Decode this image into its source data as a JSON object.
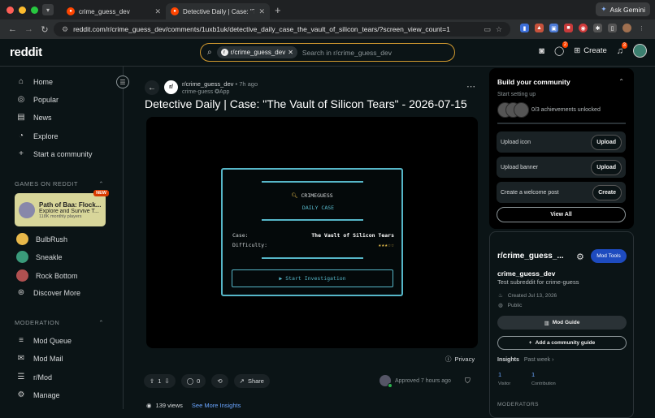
{
  "browser": {
    "tabs": [
      {
        "title": "crime_guess_dev",
        "active": false
      },
      {
        "title": "Detective Daily | Case: \"The ",
        "active": true
      }
    ],
    "gemini_label": "Ask Gemini",
    "url": "reddit.com/r/crime_guess_dev/comments/1uxb1uk/detective_daily_case_the_vault_of_silicon_tears/?screen_view_count=1"
  },
  "header": {
    "logo": "reddit",
    "search_chip": "r/crime_guess_dev",
    "search_placeholder": "Search in r/crime_guess_dev",
    "create_label": "Create",
    "chat_badge": "2",
    "notif_badge": "3"
  },
  "sidebar": {
    "nav": [
      "Home",
      "Popular",
      "News",
      "Explore",
      "Start a community"
    ],
    "games_heading": "GAMES ON REDDIT",
    "featured_game": {
      "title": "Path of Baa: Flock...",
      "subtitle": "Explore and Survive T...",
      "players": "118K monthly players",
      "badge": "NEW"
    },
    "games": [
      "BulbRush",
      "Sneakle",
      "Rock Bottom",
      "Discover More"
    ],
    "moderation_heading": "MODERATION",
    "moderation": [
      "Mod Queue",
      "Mod Mail",
      "r/Mod",
      "Manage"
    ]
  },
  "post": {
    "subreddit": "r/crime_guess_dev",
    "time": "7h ago",
    "author": "crime-guess",
    "app_tag": "App",
    "title": "Detective Daily | Case: \"The Vault of Silicon Tears\" - 2026-07-15",
    "game": {
      "brand": "CRIMEGUESS",
      "subtitle": "DAILY CASE",
      "case_label": "Case:",
      "case_value": "The Vault of Silicon Tears",
      "difficulty_label": "Difficulty:",
      "difficulty_stars": "★★★☆☆",
      "button": "▶ Start Investigation"
    },
    "privacy": "Privacy",
    "votes": "1",
    "comments": "0",
    "share": "Share",
    "approved": "Approved 7 hours ago",
    "views": "139 views",
    "insights_link": "See More Insights"
  },
  "right": {
    "build": {
      "title": "Build your community",
      "setup": "Start setting up",
      "achievements": "0/3 achievements unlocked",
      "tasks": [
        {
          "label": "Upload icon",
          "button": "Upload"
        },
        {
          "label": "Upload banner",
          "button": "Upload"
        },
        {
          "label": "Create a welcome post",
          "button": "Create"
        }
      ],
      "view_all": "View All"
    },
    "sub": {
      "name": "r/crime_guess_...",
      "mod_tools": "Mod Tools",
      "display_name": "crime_guess_dev",
      "description": "Test subreddit for crime-guess",
      "created": "Created Jul 13, 2026",
      "visibility": "Public",
      "mod_guide": "Mod Guide",
      "add_guide": "Add a community guide",
      "insights": "Insights",
      "period": "Past week ›",
      "visitors": "1",
      "visitors_label": "Visitor",
      "contributions": "1",
      "contributions_label": "Contribution",
      "moderators": "MODERATORS"
    }
  }
}
